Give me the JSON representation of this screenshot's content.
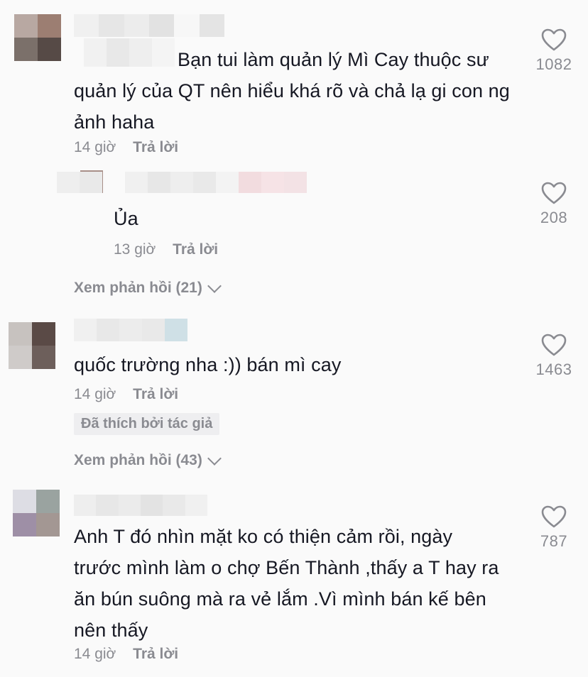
{
  "comments": [
    {
      "text": "Bạn tui làm quản lý Mì Cay thuộc sư quản lý của QT nên hiểu khá rõ và chả lạ gi con ng ảnh haha",
      "time": "14 giờ",
      "reply_label": "Trả lời",
      "likes": "1082",
      "reply": {
        "text": "Ủa",
        "time": "13 giờ",
        "reply_label": "Trả lời",
        "likes": "208"
      },
      "view_replies": "Xem phản hồi (21)"
    },
    {
      "text": "quốc trường nha :)) bán mì cay",
      "time": "14 giờ",
      "reply_label": "Trả lời",
      "liked_by_author": "Đã thích bởi tác giả",
      "likes": "1463",
      "view_replies": "Xem phản hồi (43)"
    },
    {
      "text": "Anh T đó nhìn mặt ko có thiện cảm rồi, ngày trước mình làm o chợ Bến Thành ,thấy a T hay ra ăn bún suông mà ra vẻ lắm .Vì mình bán kế bên nên thấy",
      "time": "14 giờ",
      "reply_label": "Trả lời",
      "likes": "787"
    }
  ],
  "icons": {
    "like": "heart-outline-icon",
    "expand": "chevron-down-icon"
  },
  "colors": {
    "text": "#161823",
    "muted": "#8a8b91",
    "background": "#fafafa",
    "badge_bg": "#eeeef0"
  }
}
